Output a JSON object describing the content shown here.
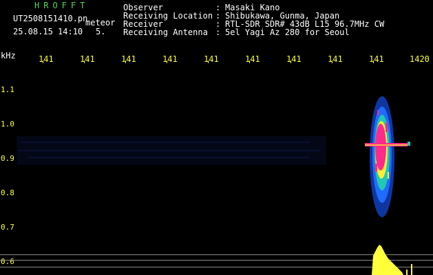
{
  "header": {
    "brand": "HROFFT",
    "filename": "UT2508151410.pn",
    "meteor_label": "meteor",
    "datetime": "25.08.15 14:10",
    "count": "5."
  },
  "meta": [
    {
      "label": "Observer",
      "value": "Masaki Kano"
    },
    {
      "label": "Receiving Location",
      "value": "Shibukawa, Gunma, Japan"
    },
    {
      "label": "Receiver",
      "value": "RTL-SDR SDR# 43dB L15 96.7MHz CW"
    },
    {
      "label": "Receiving Antenna",
      "value": "5el Yagi Az 280 for Seoul"
    }
  ],
  "axis": {
    "y_unit": "kHz",
    "y_ticks": [
      "1.1",
      "1.0",
      "0.9",
      "0.8",
      "0.7",
      "0.6"
    ],
    "x_ticks": [
      "141",
      "141",
      "141",
      "141",
      "141",
      "141",
      "141",
      "141",
      "141",
      "1420"
    ]
  },
  "colors": {
    "background": "#000000",
    "text": "#ffffff",
    "accent_green": "#55d855",
    "axis_yellow": "#ffff3c",
    "echo_core": "#ff2a8c",
    "echo_mid": "#ffee33",
    "echo_low": "#1f6cff"
  }
}
